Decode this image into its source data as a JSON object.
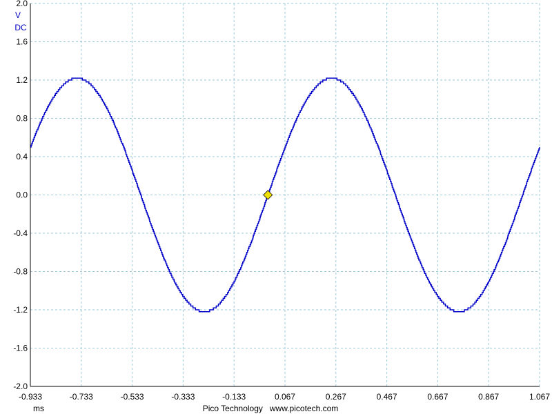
{
  "chart_data": {
    "type": "line",
    "title": "",
    "xlabel": "ms",
    "ylabel": "",
    "y_unit_lines": [
      "V",
      "DC"
    ],
    "xlim": [
      -0.933,
      1.067
    ],
    "ylim": [
      -2.0,
      2.0
    ],
    "x_ticks": [
      "-0.933",
      "-0.733",
      "-0.533",
      "-0.333",
      "-0.133",
      "0.067",
      "0.267",
      "0.467",
      "0.667",
      "0.867",
      "1.067"
    ],
    "y_ticks": [
      "2.0",
      "1.6",
      "1.2",
      "0.8",
      "0.4",
      "0.0",
      "-0.4",
      "-0.8",
      "-1.2",
      "-1.6",
      "-2.0"
    ],
    "grid": true,
    "series": [
      {
        "waveform": "sine",
        "amplitude": 1.22,
        "frequency_khz": 1.0,
        "phase_zero_crossing_ms": 0.0,
        "quantization_step": 0.02,
        "color": "#0000c8"
      }
    ],
    "trigger_marker": {
      "x": 0.0,
      "y": 0.0,
      "color": "#f0e000"
    },
    "footer": "Pico Technology   www.picotech.com"
  }
}
